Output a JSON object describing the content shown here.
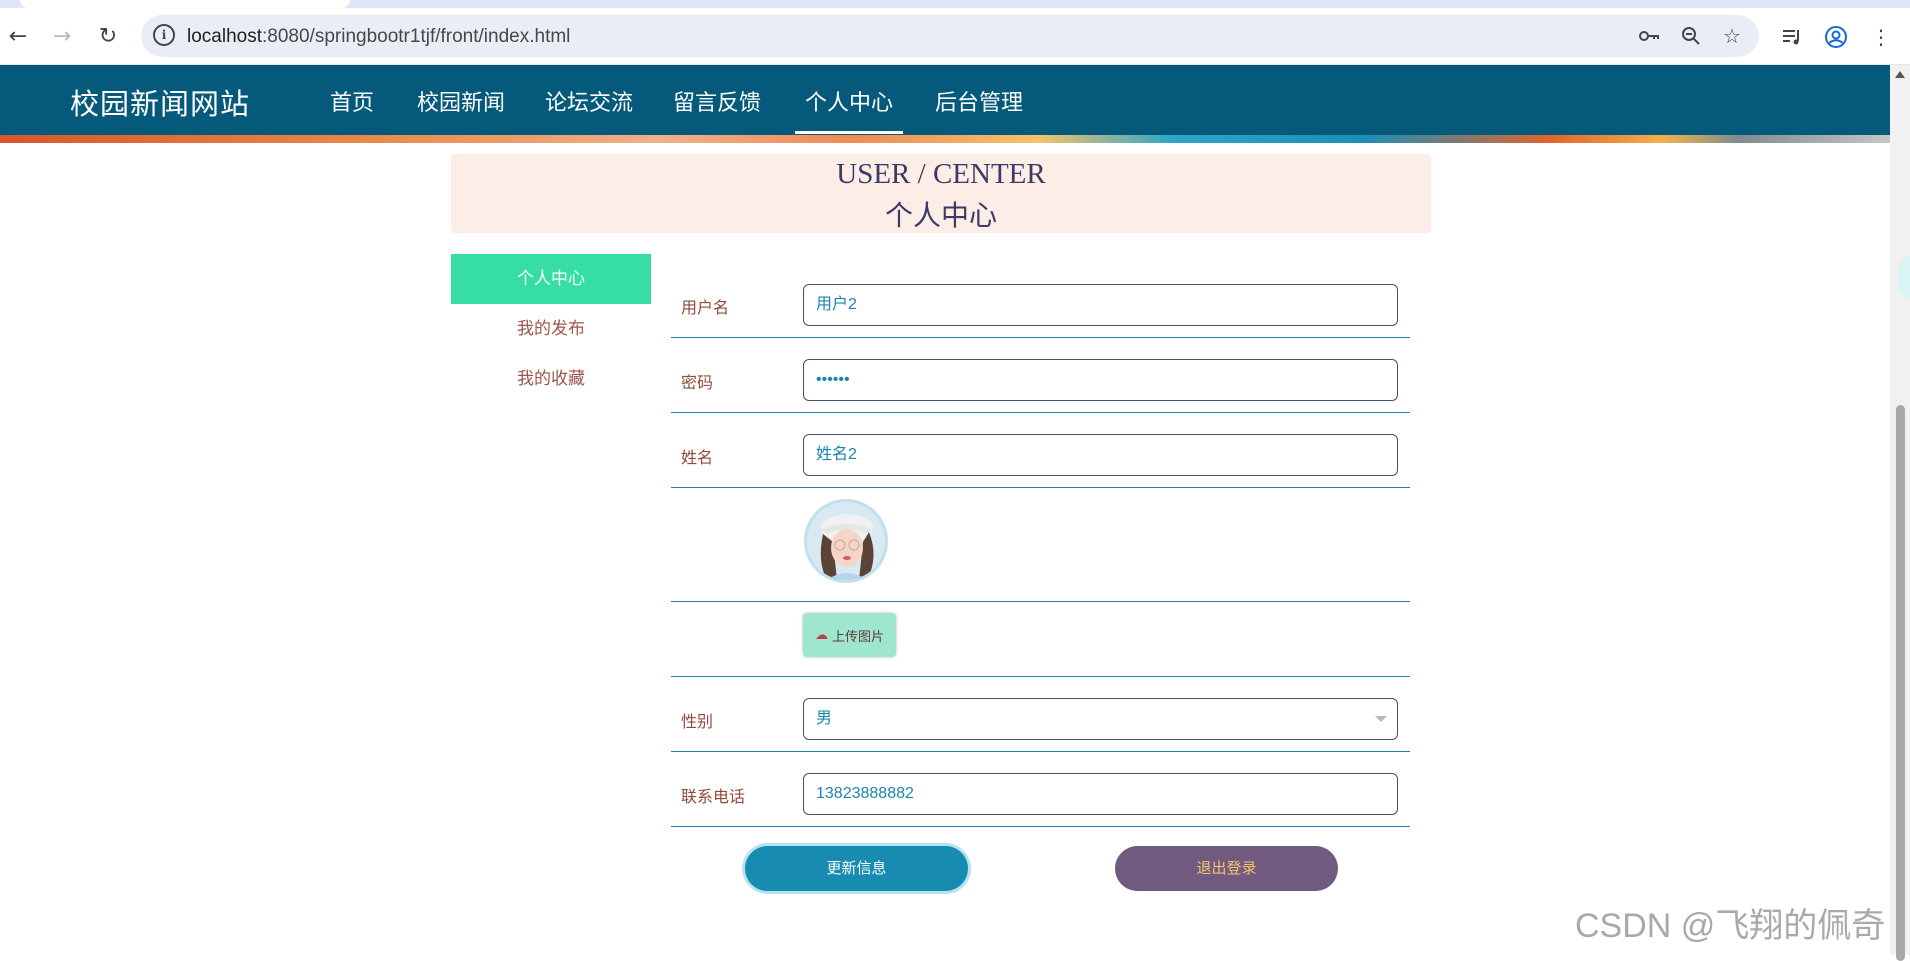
{
  "browser": {
    "url_host": "localhost",
    "url_rest": ":8080/springbootr1tjf/front/index.html"
  },
  "site": {
    "title": "校园新闻网站",
    "nav": [
      {
        "label": "首页"
      },
      {
        "label": "校园新闻"
      },
      {
        "label": "论坛交流"
      },
      {
        "label": "留言反馈"
      },
      {
        "label": "个人中心",
        "active": true
      },
      {
        "label": "后台管理"
      }
    ]
  },
  "center": {
    "title_en": "USER / CENTER",
    "title_cn": "个人中心"
  },
  "side_menu": [
    {
      "label": "个人中心",
      "active": true
    },
    {
      "label": "我的发布"
    },
    {
      "label": "我的收藏"
    }
  ],
  "form": {
    "username": {
      "label": "用户名",
      "value": "用户2"
    },
    "password": {
      "label": "密码",
      "value": "••••••"
    },
    "name": {
      "label": "姓名",
      "value": "姓名2"
    },
    "upload_label": "上传图片",
    "gender": {
      "label": "性别",
      "value": "男"
    },
    "phone": {
      "label": "联系电话",
      "value": "13823888882"
    }
  },
  "buttons": {
    "update": "更新信息",
    "logout": "退出登录"
  },
  "watermark": "CSDN @飞翔的佩奇",
  "colors": {
    "header": "#055a7b",
    "side_active": "#36dea3",
    "update_button": "#178cb0",
    "logout_button": "#715a7f"
  }
}
